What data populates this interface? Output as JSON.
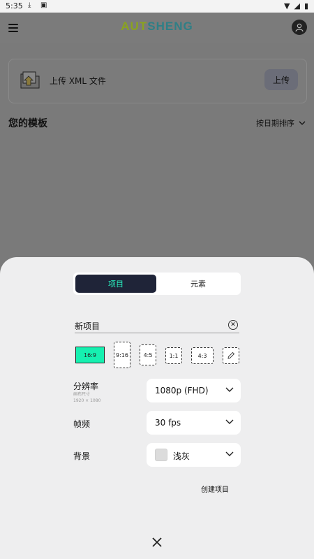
{
  "status_bar": {
    "time": "5:35"
  },
  "app_bar": {
    "brand_left": "AUT",
    "brand_right": "SHENG"
  },
  "upload_card": {
    "label": "上传 XML 文件",
    "button": "上传"
  },
  "templates": {
    "title": "您的模板",
    "sort_label": "按日期排序"
  },
  "sheet": {
    "tabs": [
      {
        "label": "项目",
        "active": true
      },
      {
        "label": "元素",
        "active": false
      }
    ],
    "project_name": "新项目",
    "aspect_ratios": [
      "16:9",
      "9:16",
      "4:5",
      "1:1",
      "4:3"
    ],
    "resolution": {
      "label": "分辨率",
      "sub_label_1": "画布尺寸",
      "sub_label_2": "1920 × 1080",
      "value": "1080p (FHD)"
    },
    "frame_rate": {
      "label": "帧频",
      "value": "30 fps"
    },
    "background": {
      "label": "背景",
      "value": "浅灰",
      "swatch_color": "#dcdcdc"
    },
    "create_label": "创建项目"
  },
  "colors": {
    "accent": "#16f0b0",
    "tab_active_bg": "#1f2438",
    "overlay": "#7b7b7b"
  }
}
